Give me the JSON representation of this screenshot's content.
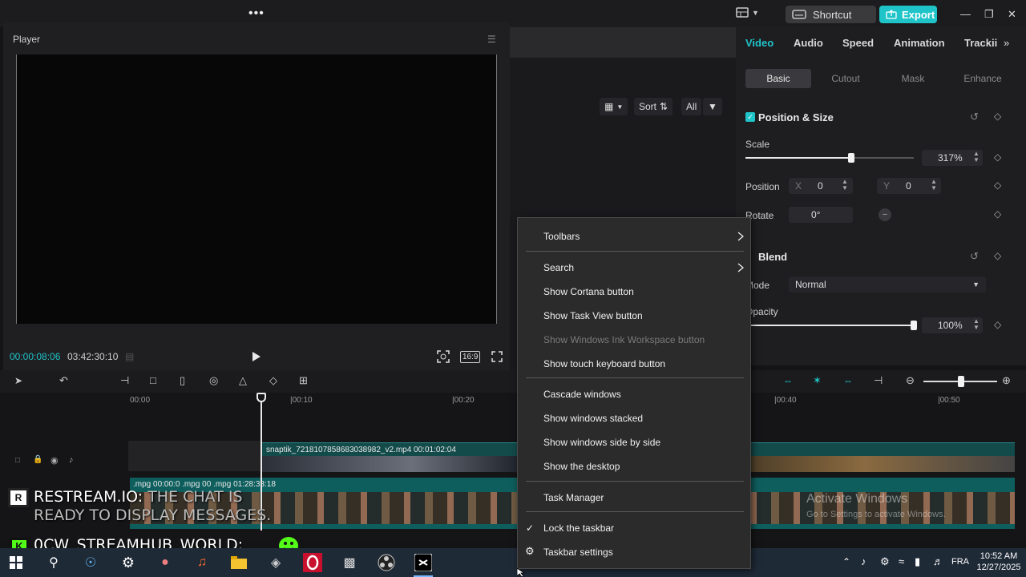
{
  "topbar": {
    "shortcut_label": "Shortcut",
    "export_label": "Export"
  },
  "player": {
    "title": "Player",
    "time_current": "00:00:08:06",
    "time_total": "03:42:30:10",
    "aspect_label": "16:9"
  },
  "media": {
    "sort_label": "Sort",
    "all_label": "All"
  },
  "inspector": {
    "tabs": [
      "Video",
      "Audio",
      "Speed",
      "Animation",
      "Trackii"
    ],
    "subtabs": [
      "Basic",
      "Cutout",
      "Mask",
      "Enhance"
    ],
    "section_position": "Position & Size",
    "scale_label": "Scale",
    "scale_value": "317%",
    "scale_fraction": 0.63,
    "position_label": "Position",
    "x_label": "X",
    "x_value": "0",
    "y_label": "Y",
    "y_value": "0",
    "rotate_label": "Rotate",
    "rotate_value": "0°",
    "blend_label": "Blend",
    "mode_label": "Mode",
    "mode_value": "Normal",
    "opacity_label": "Opacity",
    "opacity_value": "100%",
    "opacity_fraction": 1.0
  },
  "timeline": {
    "ruler": [
      "00:00",
      "|00:10",
      "|00:20",
      "|00:40",
      "|00:50"
    ],
    "clip_main_label": "snaptik_7218107858683038982_v2.mp4   00:01:02:04",
    "clip_second_labels": ".mpg  00:00:0      .mpg  00      .mpg  01:28:33:18"
  },
  "overlay": {
    "restream_badge": "R",
    "restream_line1_a": "RESTREAM.IO: ",
    "restream_line1_b": "THE CHAT IS",
    "restream_line2": "READY TO DISPLAY MESSAGES.",
    "kick_badge": "K",
    "kick_line": "0CW_STREAMHUB_WORLD:"
  },
  "context_menu": {
    "toolbars": "Toolbars",
    "search": "Search",
    "show_cortana": "Show Cortana button",
    "show_taskview": "Show Task View button",
    "show_ink": "Show Windows Ink Workspace button",
    "show_touch_keyboard": "Show touch keyboard button",
    "cascade": "Cascade windows",
    "stacked": "Show windows stacked",
    "side_by_side": "Show windows side by side",
    "show_desktop": "Show the desktop",
    "task_manager": "Task Manager",
    "lock_taskbar": "Lock the taskbar",
    "taskbar_settings": "Taskbar settings"
  },
  "activate": {
    "line1": "Activate Windows",
    "line2": "Go to Settings to activate Windows."
  },
  "taskbar": {
    "language": "FRA",
    "time": "10:52 AM",
    "date": "12/27/2025"
  },
  "colors": {
    "accent": "#1fc4c8",
    "menu_bg": "#2b2b2b",
    "taskbar_bg": "#1f2a37"
  }
}
